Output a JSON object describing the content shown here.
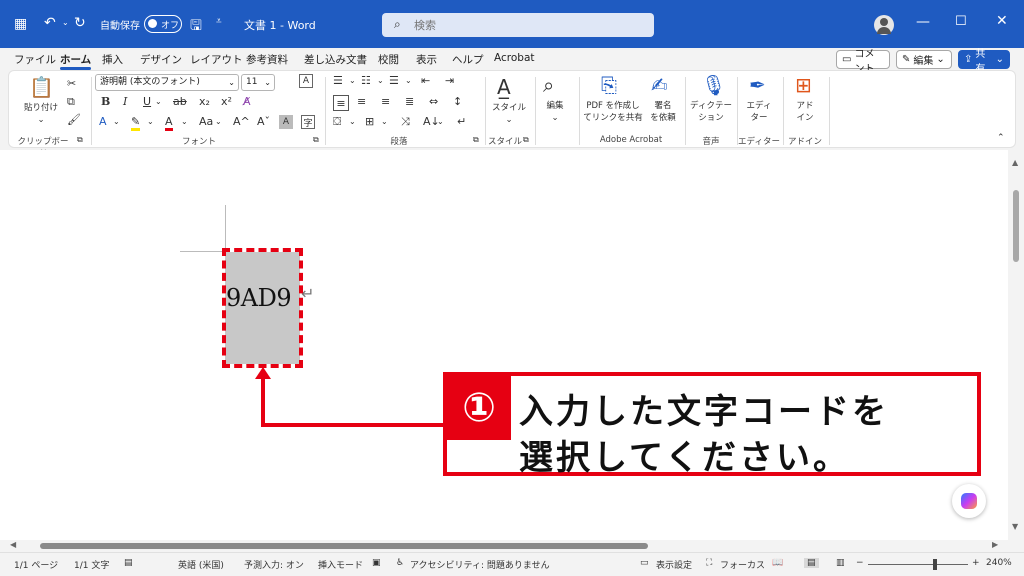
{
  "titlebar": {
    "autosave_label": "自動保存",
    "autosave_state": "オフ",
    "doc_title": "文書 1 - Word",
    "search_placeholder": "検索"
  },
  "menu": {
    "tabs": [
      "ファイル",
      "ホーム",
      "挿入",
      "デザイン",
      "レイアウト",
      "参考資料",
      "差し込み文書",
      "校閲",
      "表示",
      "ヘルプ",
      "Acrobat"
    ],
    "active_tab": "ホーム",
    "comment_label": "コメント",
    "edit_label": "編集",
    "share_label": "共有"
  },
  "ribbon": {
    "clipboard": {
      "paste_label": "貼り付け",
      "group_label": "クリップボード"
    },
    "font": {
      "font_name": "游明朝 (本文のフォント)",
      "font_size": "11",
      "group_label": "フォント"
    },
    "paragraph": {
      "group_label": "段落"
    },
    "styles": {
      "styles_label": "スタイル",
      "group_label": "スタイル"
    },
    "editing": {
      "label": "編集"
    },
    "acrobat": {
      "create_pdf_label_1": "PDF を作成し",
      "create_pdf_label_2": "てリンクを共有",
      "sign_label_1": "署名",
      "sign_label_2": "を依頼",
      "group_label": "Adobe Acrobat"
    },
    "voice": {
      "dictate_label_1": "ディクテー",
      "dictate_label_2": "ション",
      "group_label": "音声"
    },
    "editor": {
      "label_1": "エディ",
      "label_2": "ター",
      "group_label": "エディター"
    },
    "addins": {
      "label_1": "アド",
      "label_2": "イン",
      "group_label": "アドイン"
    }
  },
  "document": {
    "selected_text": "9AD9",
    "paragraph_mark": "↵"
  },
  "callout": {
    "number": "①",
    "line1": "入力した文字コードを",
    "line2": "選択してください。"
  },
  "statusbar": {
    "page": "1/1 ページ",
    "words": "1/1 文字",
    "language": "英語 (米国)",
    "predict": "予測入力: オン",
    "insert_mode": "挿入モード",
    "accessibility": "アクセシビリティ: 問題ありません",
    "display_settings": "表示設定",
    "focus": "フォーカス",
    "zoom": "240%"
  },
  "colors": {
    "accent": "#1f5bc1",
    "annotation": "#e60012"
  }
}
